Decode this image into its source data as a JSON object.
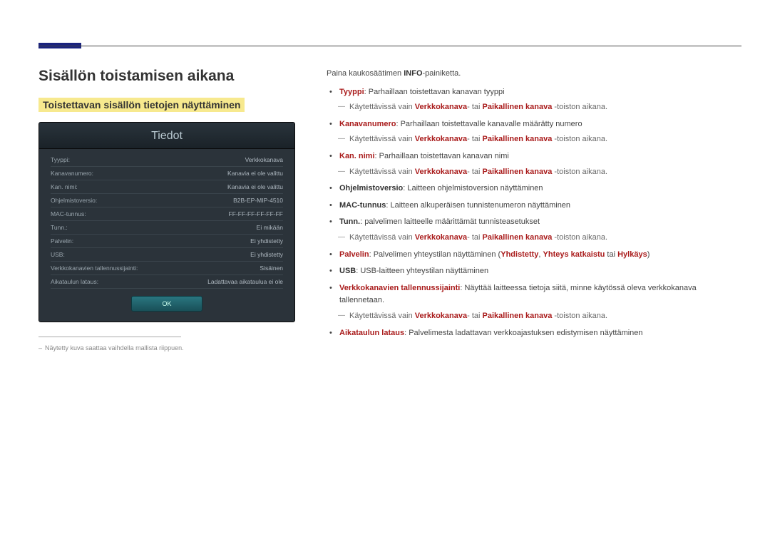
{
  "headings": {
    "main": "Sisällön toistamisen aikana",
    "section": "Toistettavan sisällön tietojen näyttäminen"
  },
  "panel": {
    "title": "Tiedot",
    "rows": [
      {
        "label": "Tyyppi:",
        "value": "Verkkokanava"
      },
      {
        "label": "Kanavanumero:",
        "value": "Kanavia ei ole valittu"
      },
      {
        "label": "Kan. nimi:",
        "value": "Kanavia ei ole valittu"
      },
      {
        "label": "Ohjelmistoversio:",
        "value": "B2B-EP-MIP-4510"
      },
      {
        "label": "MAC-tunnus:",
        "value": "FF-FF-FF-FF-FF-FF"
      },
      {
        "label": "Tunn.:",
        "value": "Ei mikään"
      },
      {
        "label": "Palvelin:",
        "value": "Ei yhdistetty"
      },
      {
        "label": "USB:",
        "value": "Ei yhdistetty"
      },
      {
        "label": "Verkkokanavien tallennussijainti:",
        "value": "Sisäinen"
      },
      {
        "label": "Aikataulun lataus:",
        "value": "Ladattavaa aikataulua ei ole"
      }
    ],
    "ok": "OK"
  },
  "footnote": "Näytetty kuva saattaa vaihdella mallista riippuen.",
  "intro": {
    "prefix": "Paina kaukosäätimen ",
    "bold": "INFO",
    "suffix": "-painiketta."
  },
  "sub_common": {
    "prefix": "Käytettävissä vain ",
    "net": "Verkkokanava",
    "mid": "- tai ",
    "local": "Paikallinen kanava",
    "suffix": " -toiston aikana."
  },
  "items": {
    "0": {
      "term": "Tyyppi",
      "desc": ": Parhaillaan toistettavan kanavan tyyppi",
      "has_sub": true
    },
    "1": {
      "term": "Kanavanumero",
      "desc": ": Parhaillaan toistettavalle kanavalle määrätty numero",
      "has_sub": true
    },
    "2": {
      "term": "Kan. nimi",
      "desc": ": Parhaillaan toistettavan kanavan nimi",
      "has_sub": true
    },
    "3": {
      "term": "Ohjelmistoversio",
      "desc": ": Laitteen ohjelmistoversion näyttäminen",
      "has_sub": false
    },
    "4": {
      "term": "MAC-tunnus",
      "desc": ": Laitteen alkuperäisen tunnistenumeron näyttäminen",
      "has_sub": false
    },
    "5": {
      "term": "Tunn.",
      "desc": ": palvelimen laitteelle määrittämät tunnisteasetukset",
      "has_sub": true
    },
    "6": {
      "term": "Palvelin",
      "desc_pre": ": Palvelimen yhteystilan näyttäminen (",
      "d1": "Yhdistetty",
      "c1": ", ",
      "d2": "Yhteys katkaistu",
      "c2": " tai ",
      "d3": "Hylkäys",
      "desc_post": ")",
      "has_sub": false
    },
    "7": {
      "term": "USB",
      "desc": ": USB-laitteen yhteystilan näyttäminen",
      "has_sub": false
    },
    "8": {
      "term": "Verkkokanavien tallennussijainti",
      "desc": ": Näyttää laitteessa tietoja siitä, minne käytössä oleva verkkokanava tallennetaan.",
      "has_sub": true
    },
    "9": {
      "term": "Aikataulun lataus",
      "desc": ": Palvelimesta ladattavan verkkoajastuksen edistymisen näyttäminen",
      "has_sub": false
    }
  }
}
